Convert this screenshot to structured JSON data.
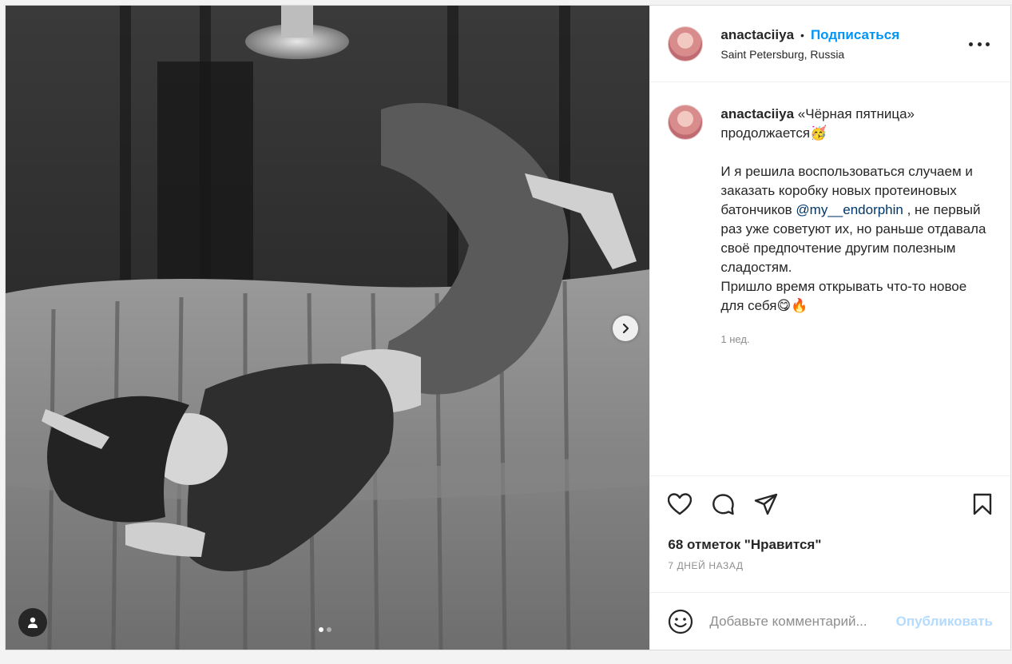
{
  "post": {
    "username": "anactaciiya",
    "follow_label": "Подписаться",
    "bullet": "•",
    "location": "Saint Petersburg, Russia"
  },
  "caption": {
    "username": "anactaciiya",
    "line1": "«Чёрная пятница» продолжается🥳",
    "line2_before_mention": "И я решила воспользоваться случаем и заказать коробку новых протеиновых батончиков ",
    "mention": "@my__endorphin",
    "line2_after_mention": " , не первый раз уже советуют их, но раньше отдавала своё предпочтение другим полезным сладостям.",
    "line3": "Пришло время открывать что-то новое для себя😋🔥",
    "time": "1 нед."
  },
  "likes_text": "68 отметок \"Нравится\"",
  "date_text": "7 ДНЕЙ НАЗАД",
  "comment": {
    "placeholder": "Добавьте комментарий...",
    "publish_label": "Опубликовать"
  },
  "icons": {
    "like": "heart-icon",
    "comment": "comment-icon",
    "share": "paper-plane-icon",
    "save": "bookmark-icon",
    "emoji": "smiley-icon",
    "more": "more-options-icon",
    "next": "chevron-right-icon",
    "tags": "user-icon"
  },
  "colors": {
    "accent": "#0095f6",
    "publish_disabled": "#b3dbff",
    "mention": "#00376b",
    "muted": "#8e8e8e"
  },
  "carousel": {
    "slides": 2,
    "active": 1
  }
}
